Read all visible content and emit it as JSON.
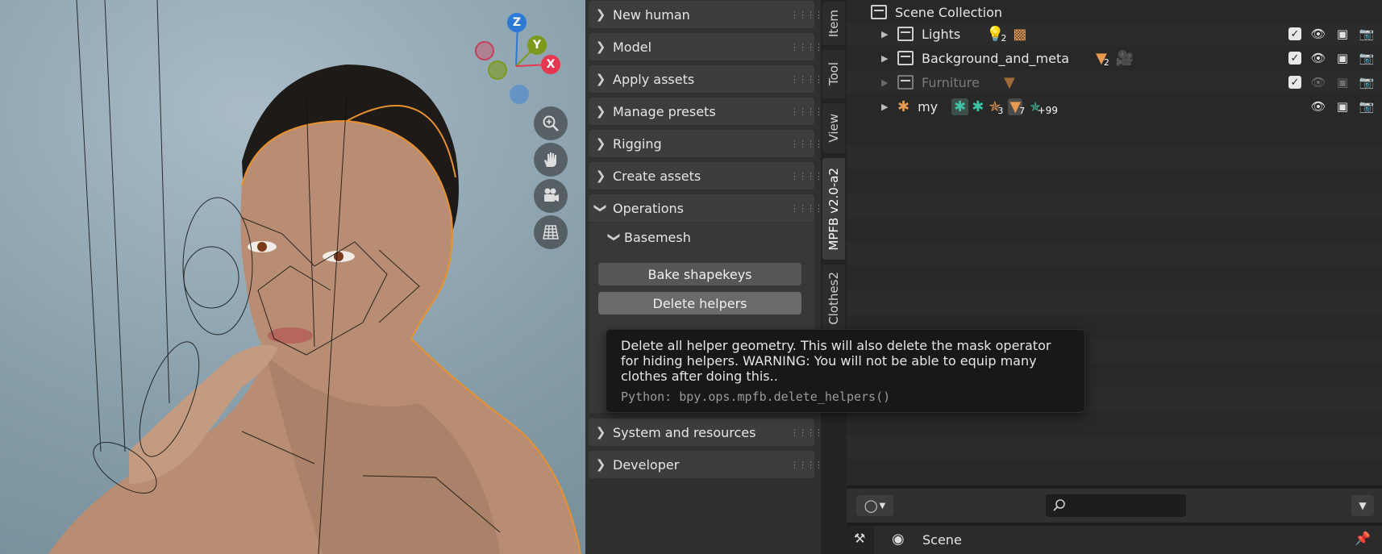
{
  "viewport": {
    "gizmo": {
      "z": "Z",
      "y": "Y",
      "x": "X"
    },
    "nav_icons": [
      "zoom-icon",
      "hand-pan-icon",
      "camera-icon",
      "grid-icon"
    ]
  },
  "npanel": {
    "panels": [
      {
        "label": "New human"
      },
      {
        "label": "Model"
      },
      {
        "label": "Apply assets"
      },
      {
        "label": "Manage presets"
      },
      {
        "label": "Rigging"
      },
      {
        "label": "Create assets"
      }
    ],
    "operations": {
      "label": "Operations",
      "basemesh": "Basemesh",
      "bake": "Bake shapekeys",
      "delete": "Delete helpers"
    },
    "bottom_panels": [
      {
        "label": "System and resources"
      },
      {
        "label": "Developer"
      }
    ]
  },
  "tabs": [
    "Item",
    "Tool",
    "View",
    "MPFB v2.0-a2",
    "Clothes2"
  ],
  "tooltip": {
    "description": "Delete all helper geometry. This will also delete the mask operator for hiding helpers. WARNING: You will not be able to equip many clothes after doing this..",
    "python": "Python: bpy.ops.mpfb.delete_helpers()"
  },
  "outliner": {
    "root": "Scene Collection",
    "items": [
      {
        "name": "Lights",
        "badge": "2"
      },
      {
        "name": "Background_and_meta",
        "badge": "2"
      },
      {
        "name": "Furniture"
      },
      {
        "name": "my",
        "badge_bone": "3",
        "badge_mesh": "7",
        "badge_more": "+99"
      }
    ]
  },
  "properties": {
    "scene_label": "Scene"
  },
  "colors": {
    "accent": "#e79a4f",
    "green": "#3fc3a5",
    "axis_x": "#e5374f",
    "axis_y": "#7b9a1c",
    "axis_z": "#2c7ad6"
  }
}
